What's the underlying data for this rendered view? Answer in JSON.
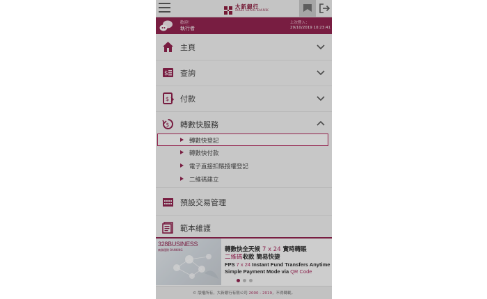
{
  "header": {
    "logo_chinese": "大新銀行",
    "logo_english": "DAH SING BANK"
  },
  "userbar": {
    "welcome_label": "歡迎！",
    "username": "執行者",
    "last_login_label": "上次登入：",
    "last_login_value": "29/10/2019 10:23:41"
  },
  "menu": [
    {
      "label": "主頁",
      "icon": "home-icon",
      "expanded": false
    },
    {
      "label": "查詢",
      "icon": "statement-icon",
      "expanded": false
    },
    {
      "label": "付款",
      "icon": "payment-icon",
      "expanded": false
    },
    {
      "label": "轉數快服務",
      "icon": "fps-icon",
      "expanded": true
    },
    {
      "label": "預設交易管理",
      "icon": "calendar-icon",
      "expanded": false
    },
    {
      "label": "範本維護",
      "icon": "template-icon",
      "expanded": false
    }
  ],
  "fps_submenu": [
    {
      "label": "轉數快登記",
      "selected": true
    },
    {
      "label": "轉數快付款",
      "selected": false
    },
    {
      "label": "電子直接扣賬授權登記",
      "selected": false
    },
    {
      "label": "二維碼建立",
      "selected": false
    }
  ],
  "banner": {
    "brand": "328BUSINESS",
    "brand_sub": "商務理財 BANKING",
    "line1_a": "轉數快全天候 ",
    "line1_accent": "7 x 24",
    "line1_b": " 實時轉賬",
    "line2_accent": "二維碼",
    "line2_b": "收款  簡易快捷",
    "line3_a": "FPS ",
    "line3_accent": "7 x 24",
    "line3_b": " Instant Fund Transfers Anytime",
    "line4_a": "Simple Payment Mode via ",
    "line4_accent": "QR Code",
    "active_slide": 1,
    "total_slides": 3
  },
  "footer": {
    "text_a": "© 版權所有，大新銀行有限公司 ",
    "years": "2000 - 2019",
    "text_b": "，不得轉載。"
  },
  "colors": {
    "brand": "#8f1a48",
    "accent": "#a8265a",
    "selected_border": "#b01e55"
  }
}
